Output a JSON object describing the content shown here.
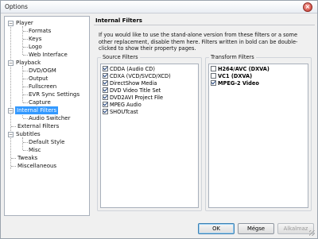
{
  "window": {
    "title": "Options",
    "close_icon": "close-icon"
  },
  "tree": {
    "items": [
      {
        "label": "Player"
      },
      {
        "label": "Formats"
      },
      {
        "label": "Keys"
      },
      {
        "label": "Logo"
      },
      {
        "label": "Web Interface"
      },
      {
        "label": "Playback"
      },
      {
        "label": "DVD/OGM"
      },
      {
        "label": "Output"
      },
      {
        "label": "Fullscreen"
      },
      {
        "label": "EVR Sync Settings"
      },
      {
        "label": "Capture"
      },
      {
        "label": "Internal Filters"
      },
      {
        "label": "Audio Switcher"
      },
      {
        "label": "External Filters"
      },
      {
        "label": "Subtitles"
      },
      {
        "label": "Default Style"
      },
      {
        "label": "Misc"
      },
      {
        "label": "Tweaks"
      },
      {
        "label": "Miscellaneous"
      }
    ],
    "expand_marker": "−"
  },
  "panel": {
    "header": "Internal Filters",
    "description": "If you would like to use the stand-alone version from these filters or a some other replacement, disable them here. Filters written in bold can be double-clicked to show their property pages.",
    "source_filters": {
      "label": "Source Filters",
      "items": [
        {
          "label": "CDDA (Audio CD)",
          "checked": true
        },
        {
          "label": "CDXA (VCD/SVCD/XCD)",
          "checked": true
        },
        {
          "label": "DirectShow Media",
          "checked": true
        },
        {
          "label": "DVD Video Title Set",
          "checked": true
        },
        {
          "label": "DVD2AVI Project File",
          "checked": true
        },
        {
          "label": "MPEG Audio",
          "checked": true
        },
        {
          "label": "SHOUTcast",
          "checked": true
        }
      ]
    },
    "transform_filters": {
      "label": "Transform Filters",
      "items": [
        {
          "label": "H264/AVC (DXVA)",
          "checked": false,
          "bold": true
        },
        {
          "label": "VC1 (DXVA)",
          "checked": false,
          "bold": true
        },
        {
          "label": "MPEG-2 Video",
          "checked": true,
          "bold": true
        }
      ]
    }
  },
  "buttons": {
    "ok": "OK",
    "cancel": "Mégse",
    "apply": "Alkalmaz"
  }
}
